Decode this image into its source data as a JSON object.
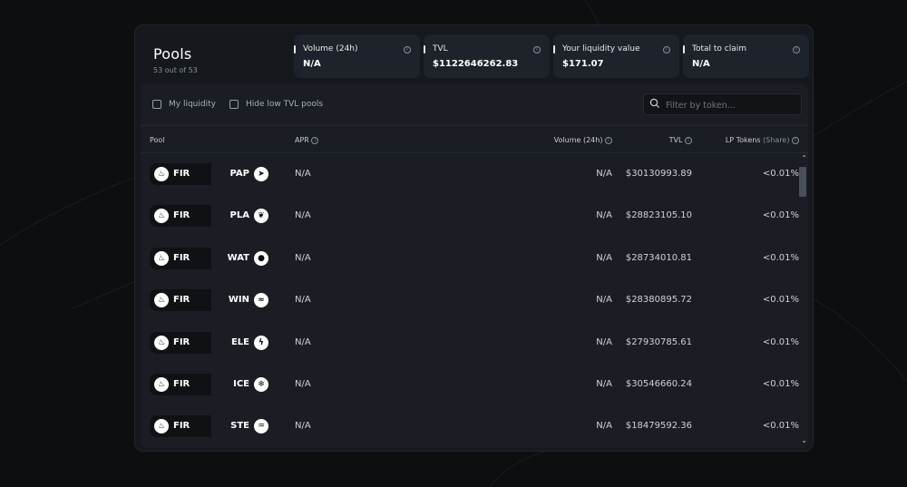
{
  "header": {
    "title": "Pools",
    "subtitle": "53 out of 53"
  },
  "stats": [
    {
      "label": "Volume (24h)",
      "value": "N/A"
    },
    {
      "label": "TVL",
      "value": "$1122646262.83"
    },
    {
      "label": "Your liquidity value",
      "value": "$171.07"
    },
    {
      "label": "Total to claim",
      "value": "N/A"
    }
  ],
  "filters": {
    "my_liquidity": "My liquidity",
    "hide_low_tvl": "Hide low TVL pools",
    "search_placeholder": "Filter by token..."
  },
  "table": {
    "headers": {
      "pool": "Pool",
      "apr": "APR",
      "volume": "Volume (24h)",
      "tvl": "TVL",
      "lp": "LP Tokens",
      "lp_suffix": "(Share)"
    },
    "rows": [
      {
        "token_a": "FIR",
        "icon_a": "fire-icon",
        "token_b": "PAP",
        "icon_b": "paper-plane-icon",
        "apr": "N/A",
        "volume": "N/A",
        "tvl": "$30130993.89",
        "lp": "<0.01%"
      },
      {
        "token_a": "FIR",
        "icon_a": "fire-icon",
        "token_b": "PLA",
        "icon_b": "plant-icon",
        "apr": "N/A",
        "volume": "N/A",
        "tvl": "$28823105.10",
        "lp": "<0.01%"
      },
      {
        "token_a": "FIR",
        "icon_a": "fire-icon",
        "token_b": "WAT",
        "icon_b": "water-drop-icon",
        "apr": "N/A",
        "volume": "N/A",
        "tvl": "$28734010.81",
        "lp": "<0.01%"
      },
      {
        "token_a": "FIR",
        "icon_a": "fire-icon",
        "token_b": "WIN",
        "icon_b": "wind-icon",
        "apr": "N/A",
        "volume": "N/A",
        "tvl": "$28380895.72",
        "lp": "<0.01%"
      },
      {
        "token_a": "FIR",
        "icon_a": "fire-icon",
        "token_b": "ELE",
        "icon_b": "lightning-icon",
        "apr": "N/A",
        "volume": "N/A",
        "tvl": "$27930785.61",
        "lp": "<0.01%"
      },
      {
        "token_a": "FIR",
        "icon_a": "fire-icon",
        "token_b": "ICE",
        "icon_b": "snowflake-icon",
        "apr": "N/A",
        "volume": "N/A",
        "tvl": "$30546660.24",
        "lp": "<0.01%"
      },
      {
        "token_a": "FIR",
        "icon_a": "fire-icon",
        "token_b": "STE",
        "icon_b": "steam-icon",
        "apr": "N/A",
        "volume": "N/A",
        "tvl": "$18479592.36",
        "lp": "<0.01%"
      }
    ]
  }
}
